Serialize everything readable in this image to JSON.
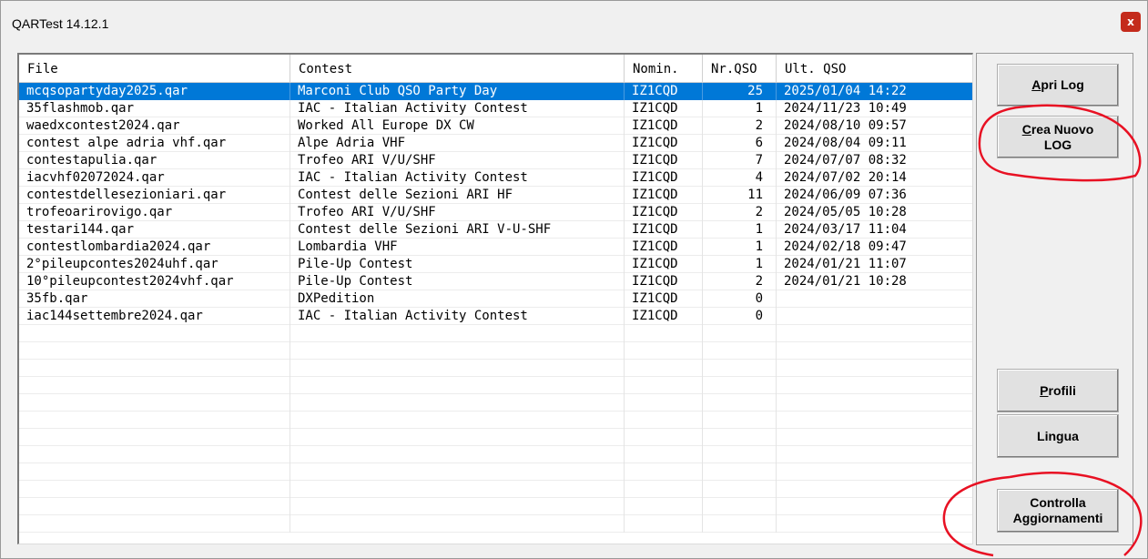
{
  "window": {
    "title": "QARTest 14.12.1",
    "close_glyph": "x"
  },
  "table": {
    "columns": [
      "File",
      "Contest",
      "Nomin.",
      "Nr.QSO",
      "Ult. QSO"
    ],
    "rows": [
      {
        "file": "mcqsopartyday2025.qar",
        "contest": "Marconi Club QSO Party Day",
        "nomin": "IZ1CQD",
        "nr": "25",
        "ult": "2025/01/04 14:22",
        "selected": true
      },
      {
        "file": "35flashmob.qar",
        "contest": "IAC - Italian Activity Contest",
        "nomin": "IZ1CQD",
        "nr": "1",
        "ult": "2024/11/23 10:49"
      },
      {
        "file": "waedxcontest2024.qar",
        "contest": "Worked All Europe DX CW",
        "nomin": "IZ1CQD",
        "nr": "2",
        "ult": "2024/08/10 09:57"
      },
      {
        "file": "contest alpe adria vhf.qar",
        "contest": "Alpe Adria VHF",
        "nomin": "IZ1CQD",
        "nr": "6",
        "ult": "2024/08/04 09:11"
      },
      {
        "file": "contestapulia.qar",
        "contest": "Trofeo ARI V/U/SHF",
        "nomin": "IZ1CQD",
        "nr": "7",
        "ult": "2024/07/07 08:32"
      },
      {
        "file": "iacvhf02072024.qar",
        "contest": "IAC - Italian Activity Contest",
        "nomin": "IZ1CQD",
        "nr": "4",
        "ult": "2024/07/02 20:14"
      },
      {
        "file": "contestdellesezioniari.qar",
        "contest": "Contest delle Sezioni ARI HF",
        "nomin": "IZ1CQD",
        "nr": "11",
        "ult": "2024/06/09 07:36"
      },
      {
        "file": "trofeoarirovigo.qar",
        "contest": "Trofeo ARI V/U/SHF",
        "nomin": "IZ1CQD",
        "nr": "2",
        "ult": "2024/05/05 10:28"
      },
      {
        "file": "testari144.qar",
        "contest": "Contest delle Sezioni ARI V-U-SHF",
        "nomin": "IZ1CQD",
        "nr": "1",
        "ult": "2024/03/17 11:04"
      },
      {
        "file": "contestlombardia2024.qar",
        "contest": "Lombardia VHF",
        "nomin": "IZ1CQD",
        "nr": "1",
        "ult": "2024/02/18 09:47"
      },
      {
        "file": "2°pileupcontes2024uhf.qar",
        "contest": "Pile-Up Contest",
        "nomin": "IZ1CQD",
        "nr": "1",
        "ult": "2024/01/21 11:07"
      },
      {
        "file": "10°pileupcontest2024vhf.qar",
        "contest": "Pile-Up Contest",
        "nomin": "IZ1CQD",
        "nr": "2",
        "ult": "2024/01/21 10:28"
      },
      {
        "file": "35fb.qar",
        "contest": "DXPedition",
        "nomin": "IZ1CQD",
        "nr": "0",
        "ult": ""
      },
      {
        "file": "iac144settembre2024.qar",
        "contest": "IAC - Italian Activity Contest",
        "nomin": "IZ1CQD",
        "nr": "0",
        "ult": ""
      }
    ]
  },
  "buttons": {
    "apri_log": {
      "mnemonic": "A",
      "rest": "pri Log"
    },
    "crea_nuovo": {
      "mnemonic": "C",
      "rest": "rea Nuovo",
      "line2": "LOG"
    },
    "profili": {
      "mnemonic": "P",
      "rest": "rofili"
    },
    "lingua": "Lingua",
    "controlla": {
      "line1": "Controlla",
      "line2": "Aggiornamenti"
    }
  },
  "annotation_color": "#e81123"
}
